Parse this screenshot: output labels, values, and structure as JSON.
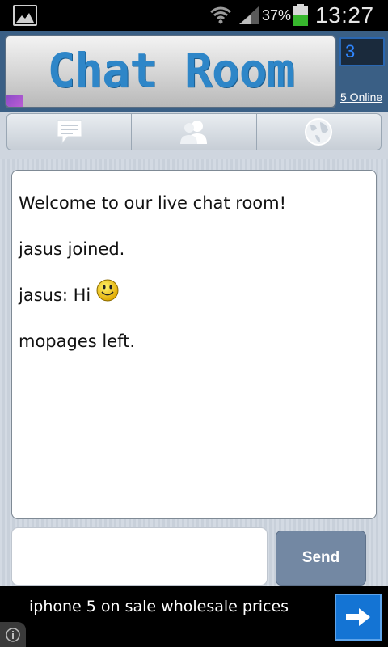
{
  "status_bar": {
    "battery_percent": "37%",
    "time": "13:27",
    "icons": [
      "gallery-icon",
      "wifi-icon",
      "signal-icon",
      "battery-icon"
    ]
  },
  "header": {
    "title": "Chat Room",
    "count": "3",
    "online_link": "5 Online",
    "title_color": "#2e86c8"
  },
  "tabs": [
    {
      "name": "chat",
      "icon": "chat-bubble-icon"
    },
    {
      "name": "users",
      "icon": "users-icon"
    },
    {
      "name": "rooms",
      "icon": "globe-icon"
    }
  ],
  "chat": {
    "messages": [
      {
        "text": "Welcome to our live chat room!"
      },
      {
        "text": "jasus joined."
      },
      {
        "text": "jasus: Hi",
        "emoji": "smiley-icon"
      },
      {
        "text": "mopages left."
      }
    ]
  },
  "composer": {
    "input_value": "",
    "send_label": "Send"
  },
  "ad": {
    "text": "iphone 5 on sale wholesale prices",
    "arrow_icon": "arrow-right-icon",
    "info_icon": "info-icon"
  },
  "colors": {
    "header_bg": "#3a5f85",
    "send_button": "#7388a3",
    "ad_arrow": "#1474d4"
  }
}
